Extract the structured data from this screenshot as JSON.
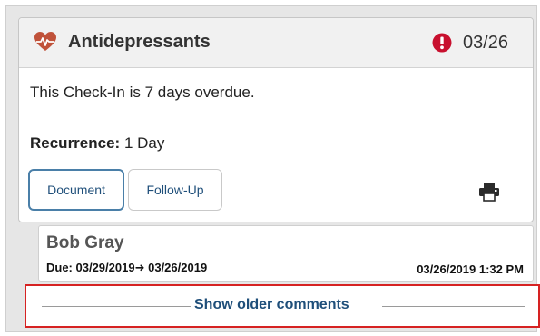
{
  "card": {
    "title": "Antidepressants",
    "due_date": "03/26",
    "overdue_message": "This Check-In is 7 days overdue.",
    "recurrence_label": "Recurrence:",
    "recurrence_value": "1 Day",
    "buttons": {
      "document": "Document",
      "follow_up": "Follow-Up"
    },
    "icons": {
      "title": "heart-pulse-icon",
      "alert": "exclamation-circle-icon",
      "print": "printer-icon"
    },
    "colors": {
      "heart": "#c0523a",
      "alert": "#c8102e",
      "link": "#1f4f7a",
      "highlight_border": "#d62222"
    }
  },
  "comment": {
    "author": "Bob Gray",
    "due_label": "Due: 03/29/2019",
    "due_arrow": "➜",
    "due_new": "03/26/2019",
    "timestamp": "03/26/2019 1:32 PM"
  },
  "older_comments": {
    "label": "Show older comments"
  }
}
